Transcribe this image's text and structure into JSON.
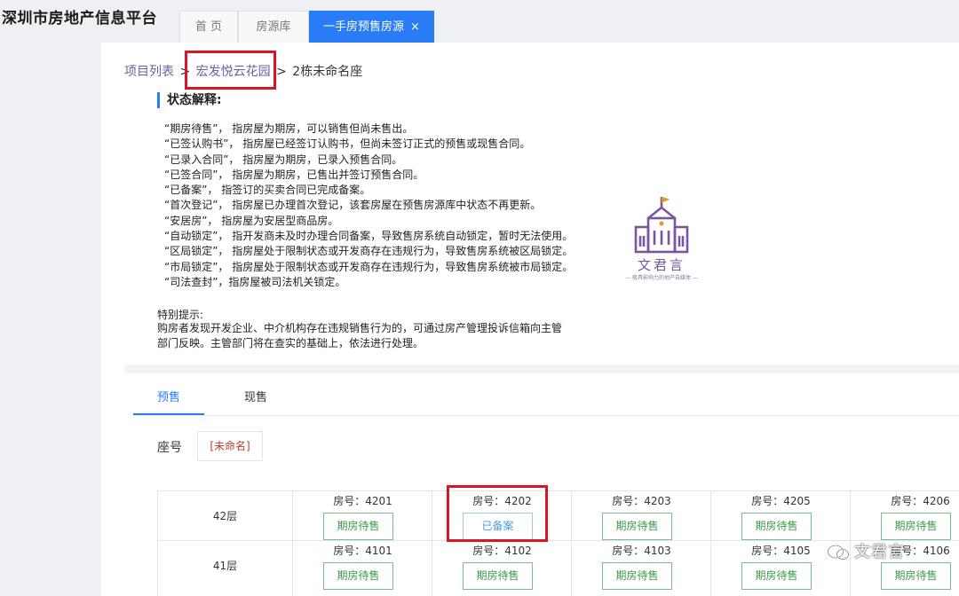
{
  "header": {
    "site_title": "深圳市房地产信息平台",
    "tabs": [
      {
        "label": "首 页"
      },
      {
        "label": "房源库"
      },
      {
        "label": "一手房预售房源",
        "close": "×"
      }
    ]
  },
  "breadcrumb": {
    "items": [
      "项目列表",
      "宏发悦云花园",
      "2栋未命名座"
    ],
    "separator": ">"
  },
  "status_explanation": {
    "heading": "状态解释:",
    "lines": [
      "“期房待售”，  指房屋为期房，可以销售但尚未售出。",
      "“已签认购书”，   指房屋已经签订认购书，但尚未签订正式的预售或现售合同。",
      "“已录入合同”，   指房屋为期房，已录入预售合同。",
      "“已签合同”，  指房屋为期房，已售出并签订预售合同。",
      "“已备案”，  指签订的买卖合同已完成备案。",
      "“首次登记”，  指房屋已办理首次登记，该套房屋在预售房源库中状态不再更新。",
      "“安居房”，  指房屋为安居型商品房。",
      "“自动锁定”，  指开发商未及时办理合同备案，导致售房系统自动锁定，暂时无法使用。",
      "“区局锁定”，   指房屋处于限制状态或开发商存在违规行为，导致售房系统被区局锁定。",
      "“市局锁定”，   指房屋处于限制状态或开发商存在违规行为，导致售房系统被市局锁定。",
      "“司法查封”，指房屋被司法机关锁定。"
    ]
  },
  "special_notice": {
    "title": "特别提示:",
    "lines": [
      "购房者发现开发企业、中介机构存在违规销售行为的，可通过房产管理投诉信箱向主管",
      "部门反映。主管部门将在查实的基础上，依法进行处理。"
    ]
  },
  "logo": {
    "name": "文君言",
    "subtitle": "— 极具影响力的地产自媒体 —",
    "color": "#7b56a0"
  },
  "sale_tabs": [
    {
      "label": "预售"
    },
    {
      "label": "现售"
    }
  ],
  "building": {
    "label": "座号",
    "chip": "[未命名]"
  },
  "floors": [
    {
      "label": "42层",
      "units": [
        {
          "number": "房号：4201",
          "status": "期房待售",
          "filed": false
        },
        {
          "number": "房号：4202",
          "status": "已备案",
          "filed": true
        },
        {
          "number": "房号：4203",
          "status": "期房待售",
          "filed": false
        },
        {
          "number": "房号：4205",
          "status": "期房待售",
          "filed": false
        },
        {
          "number": "房号：4206",
          "status": "期房待售",
          "filed": false
        }
      ]
    },
    {
      "label": "41层",
      "units": [
        {
          "number": "房号：4101",
          "status": "期房待售",
          "filed": false
        },
        {
          "number": "房号：4102",
          "status": "期房待售",
          "filed": false
        },
        {
          "number": "房号：4103",
          "status": "期房待售",
          "filed": false
        },
        {
          "number": "房号：4105",
          "status": "期房待售",
          "filed": false
        },
        {
          "number": "房号：4106",
          "status": "期房待售",
          "filed": false
        }
      ]
    }
  ],
  "watermark": {
    "text": "文君言",
    "icon": "wechat-icon"
  },
  "colors": {
    "accent": "#2a7bf6",
    "highlight_red": "#d9152a",
    "status_green": "#3c9a4a",
    "status_filed_blue": "#4b9be0"
  }
}
